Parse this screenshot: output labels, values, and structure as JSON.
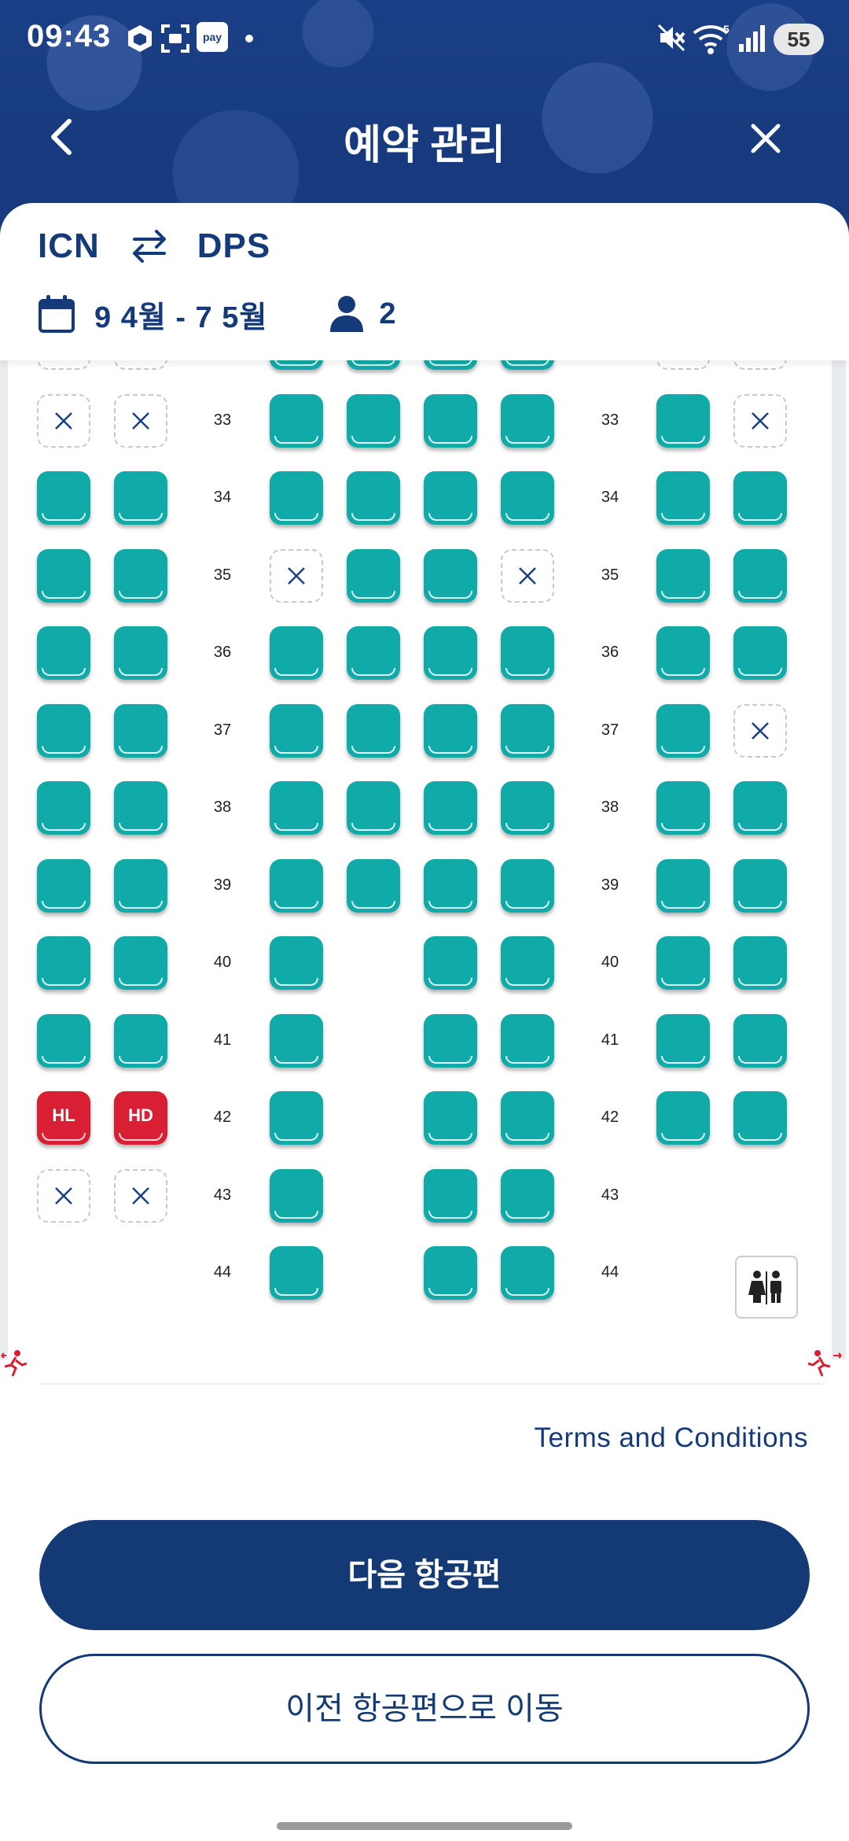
{
  "status_bar": {
    "time": "09:43",
    "pay_badge": "pay",
    "battery": "55",
    "icons": [
      "cube-icon",
      "screenshot-icon",
      "pay-icon",
      "mute-icon",
      "wifi-icon",
      "signal-icon",
      "battery-icon"
    ]
  },
  "header": {
    "title": "예약 관리",
    "back_icon": "chevron-left-icon",
    "close_icon": "close-icon"
  },
  "trip": {
    "origin": "ICN",
    "destination": "DPS",
    "dates": "9 4월 - 7 5월",
    "passengers": "2"
  },
  "seat_map": {
    "colors": {
      "available": "#10aaa8",
      "special": "#d81f34",
      "unavailable_border": "#c9c9c9"
    },
    "rows": [
      {
        "num": "",
        "seats": [
          "X",
          "X",
          "A",
          "A",
          "A",
          "A",
          "X",
          "X"
        ]
      },
      {
        "num": "33",
        "seats": [
          "X",
          "X",
          "A",
          "A",
          "A",
          "A",
          "A",
          "X"
        ]
      },
      {
        "num": "34",
        "seats": [
          "A",
          "A",
          "A",
          "A",
          "A",
          "A",
          "A",
          "A"
        ]
      },
      {
        "num": "35",
        "seats": [
          "A",
          "A",
          "X",
          "A",
          "A",
          "X",
          "A",
          "A"
        ]
      },
      {
        "num": "36",
        "seats": [
          "A",
          "A",
          "A",
          "A",
          "A",
          "A",
          "A",
          "A"
        ]
      },
      {
        "num": "37",
        "seats": [
          "A",
          "A",
          "A",
          "A",
          "A",
          "A",
          "A",
          "X"
        ]
      },
      {
        "num": "38",
        "seats": [
          "A",
          "A",
          "A",
          "A",
          "A",
          "A",
          "A",
          "A"
        ]
      },
      {
        "num": "39",
        "seats": [
          "A",
          "A",
          "A",
          "A",
          "A",
          "A",
          "A",
          "A"
        ]
      },
      {
        "num": "40",
        "seats": [
          "A",
          "A",
          "A",
          "",
          "A",
          "A",
          "A",
          "A"
        ]
      },
      {
        "num": "41",
        "seats": [
          "A",
          "A",
          "A",
          "",
          "A",
          "A",
          "A",
          "A"
        ]
      },
      {
        "num": "42",
        "seats": [
          "HL",
          "HD",
          "A",
          "",
          "A",
          "A",
          "A",
          "A"
        ]
      },
      {
        "num": "43",
        "seats": [
          "X",
          "X",
          "A",
          "",
          "A",
          "A",
          "",
          ""
        ]
      },
      {
        "num": "44",
        "seats": [
          "",
          "",
          "A",
          "",
          "A",
          "A",
          "",
          ""
        ]
      }
    ],
    "lavatory_icon": "lavatory-icon",
    "exit_icon": "emergency-exit-icon"
  },
  "footer": {
    "terms": "Terms and Conditions",
    "next_button": "다음 항공편",
    "prev_button": "이전 항공편으로 이동"
  }
}
